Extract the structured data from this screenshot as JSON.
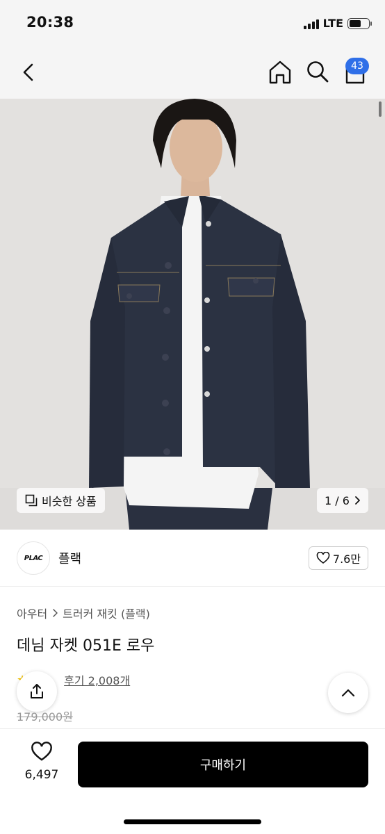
{
  "status_bar": {
    "time": "20:38",
    "network": "LTE",
    "battery_level": 0.6
  },
  "nav": {
    "cart_count": "43",
    "icons": [
      "chevron-left-icon",
      "home-icon",
      "search-icon",
      "shopping-bag-icon"
    ]
  },
  "gallery": {
    "similar_label": "비슷한 상품",
    "pager": "1 / 6"
  },
  "brand": {
    "logo_text": "PLAC",
    "name": "플랙",
    "likes": "7.6만"
  },
  "product": {
    "breadcrumb": [
      "아우터",
      "트러커 재킷 (플랙)"
    ],
    "title": "데님 자켓 051E 로우",
    "review_label": "후기 2,008개",
    "original_price": "179,000원"
  },
  "bottom_bar": {
    "wish_count": "6,497",
    "buy_label": "구매하기"
  },
  "colors": {
    "accent": "#2f6fe8",
    "buy_button": "#000000",
    "star": "#f2c200"
  }
}
